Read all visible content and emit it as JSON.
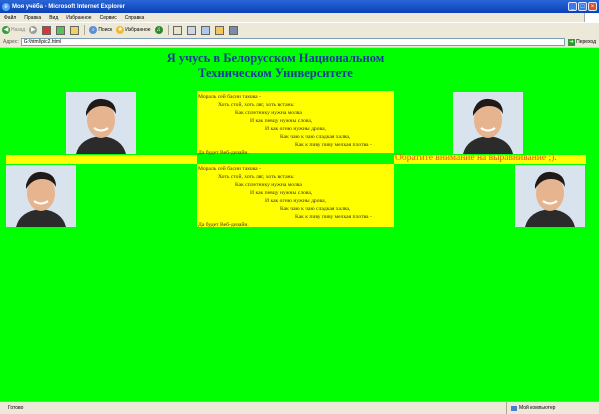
{
  "window": {
    "title": "Моя учёба - Microsoft Internet Explorer",
    "controls": [
      "_",
      "□",
      "×"
    ]
  },
  "menu": [
    "Файл",
    "Правка",
    "Вид",
    "Избранное",
    "Сервис",
    "Справка"
  ],
  "toolbar": {
    "back": "Назад",
    "search": "Поиск",
    "favorites": "Избранное"
  },
  "address": {
    "label": "Адрес:",
    "value": "G:\\html\\pic2.html",
    "go": "Переход"
  },
  "page": {
    "heading_line1": "Я учусь в Белорусском Национальном",
    "heading_line2": "Техническом Университете",
    "poem": [
      "Мораль сей басни такова -",
      "Хоть стой, хоть ляг, хоть встань:",
      "Как сплетнику нужна молва",
      "И как певцу нужны слова,",
      "И как огню нужны дрова,",
      "Как чаю к чаю сладкая халва,",
      "Как к пиву пиву мелкая плотва -",
      "Да будет Веб-дизайн."
    ],
    "notice": "Обратите внимание на выравнивание ;)."
  },
  "status": {
    "text": "Готово",
    "zone": "Мой компьютер"
  },
  "colors": {
    "page_bg": "#00ff00",
    "poem_bg": "#ffff00",
    "heading": "#1a3aa0",
    "notice": "#e05a10"
  }
}
